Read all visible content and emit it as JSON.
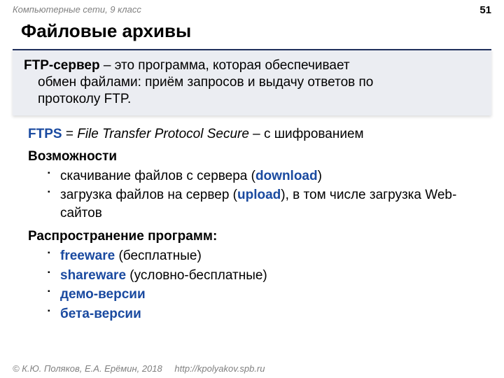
{
  "header": {
    "course": "Компьютерные сети, 9 класс",
    "page_number": "51"
  },
  "title": "Файловые архивы",
  "definition": {
    "term": "FTP-сервер",
    "dash": " – ",
    "line1_rest": "это программа, которая обеспечивает",
    "line2": "обмен файлами: приём запросов и выдачу ответов по",
    "line3": "протоколу FTP."
  },
  "ftps": {
    "abbr": "FTPS",
    "eq": " = ",
    "expansion": "File Transfer Protocol Secure",
    "tail": " – с шифрованием"
  },
  "capabilities": {
    "heading": "Возможности",
    "items": [
      {
        "pre": "скачивание файлов с сервера (",
        "kw": "download",
        "post": ")"
      },
      {
        "pre": "загрузка файлов на сервер (",
        "kw": "upload",
        "post": "), в том числе загрузка Web-сайтов"
      }
    ]
  },
  "distribution": {
    "heading": "Распространение программ:",
    "items": [
      {
        "kw": "freeware",
        "post": " (бесплатные)"
      },
      {
        "kw": "shareware",
        "post": " (условно-бесплатные)"
      },
      {
        "kw": "демо-версии",
        "post": ""
      },
      {
        "kw": "бета-версии",
        "post": ""
      }
    ]
  },
  "footer": {
    "copyright": "© К.Ю. Поляков, Е.А. Ерёмин, 2018",
    "url": "http://kpolyakov.spb.ru"
  }
}
